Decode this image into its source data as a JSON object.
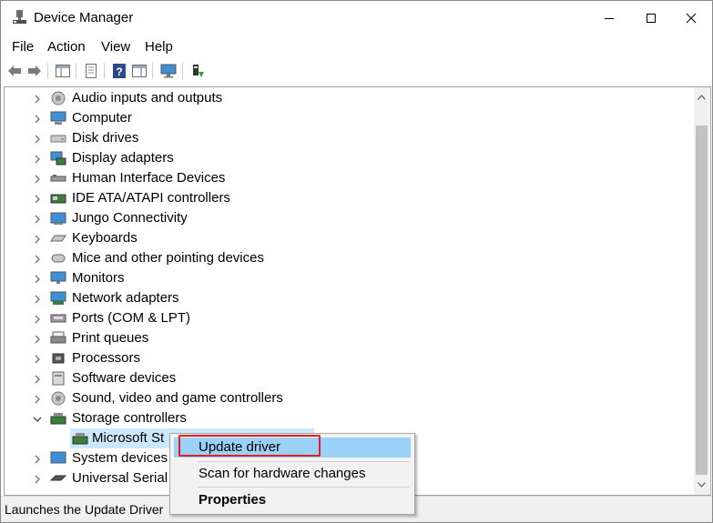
{
  "window": {
    "title": "Device Manager",
    "app_icon": "device-manager-icon",
    "controls": {
      "minimize": "minimize-icon",
      "maximize": "maximize-icon",
      "close": "close-icon"
    }
  },
  "menubar": {
    "items": [
      "File",
      "Action",
      "View",
      "Help"
    ]
  },
  "toolbar": {
    "buttons": [
      "back-icon",
      "forward-icon",
      "show-hide-console-tree-icon",
      "properties-icon",
      "help-icon",
      "show-action-pane-icon",
      "monitor-icon",
      "update-driver-icon"
    ]
  },
  "tree": {
    "nodes": [
      {
        "label": "Audio inputs and outputs",
        "icon": "speaker-icon",
        "expanded": false
      },
      {
        "label": "Computer",
        "icon": "computer-icon",
        "expanded": false
      },
      {
        "label": "Disk drives",
        "icon": "disk-drive-icon",
        "expanded": false
      },
      {
        "label": "Display adapters",
        "icon": "display-adapter-icon",
        "expanded": false
      },
      {
        "label": "Human Interface Devices",
        "icon": "hid-icon",
        "expanded": false
      },
      {
        "label": "IDE ATA/ATAPI controllers",
        "icon": "ide-controller-icon",
        "expanded": false
      },
      {
        "label": "Jungo Connectivity",
        "icon": "jungo-icon",
        "expanded": false
      },
      {
        "label": "Keyboards",
        "icon": "keyboard-icon",
        "expanded": false
      },
      {
        "label": "Mice and other pointing devices",
        "icon": "mouse-icon",
        "expanded": false
      },
      {
        "label": "Monitors",
        "icon": "monitor-icon",
        "expanded": false
      },
      {
        "label": "Network adapters",
        "icon": "network-adapter-icon",
        "expanded": false
      },
      {
        "label": "Ports (COM & LPT)",
        "icon": "port-icon",
        "expanded": false
      },
      {
        "label": "Print queues",
        "icon": "printer-icon",
        "expanded": false
      },
      {
        "label": "Processors",
        "icon": "processor-icon",
        "expanded": false
      },
      {
        "label": "Software devices",
        "icon": "software-device-icon",
        "expanded": false
      },
      {
        "label": "Sound, video and game controllers",
        "icon": "sound-controller-icon",
        "expanded": false
      },
      {
        "label": "Storage controllers",
        "icon": "storage-controller-icon",
        "expanded": true
      },
      {
        "label": "Microsoft Storage Spaces Controller",
        "visible_label": "Microsoft St",
        "icon": "storage-controller-icon",
        "child": true,
        "selected": true
      },
      {
        "label": "System devices",
        "icon": "system-device-icon",
        "expanded": false
      },
      {
        "label": "Universal Serial",
        "icon": "usb-icon",
        "expanded": false
      }
    ]
  },
  "context_menu": {
    "items": [
      {
        "label": "Update driver",
        "highlighted": true,
        "bold": false
      },
      {
        "label": "Scan for hardware changes",
        "highlighted": false,
        "bold": false
      },
      {
        "label": "Properties",
        "highlighted": false,
        "bold": true
      }
    ]
  },
  "status": {
    "text": "Launches the Update Driver"
  },
  "colors": {
    "highlight": "#9bd0f7",
    "selection": "#cce8ff",
    "annotation_box": "#e31b23"
  }
}
